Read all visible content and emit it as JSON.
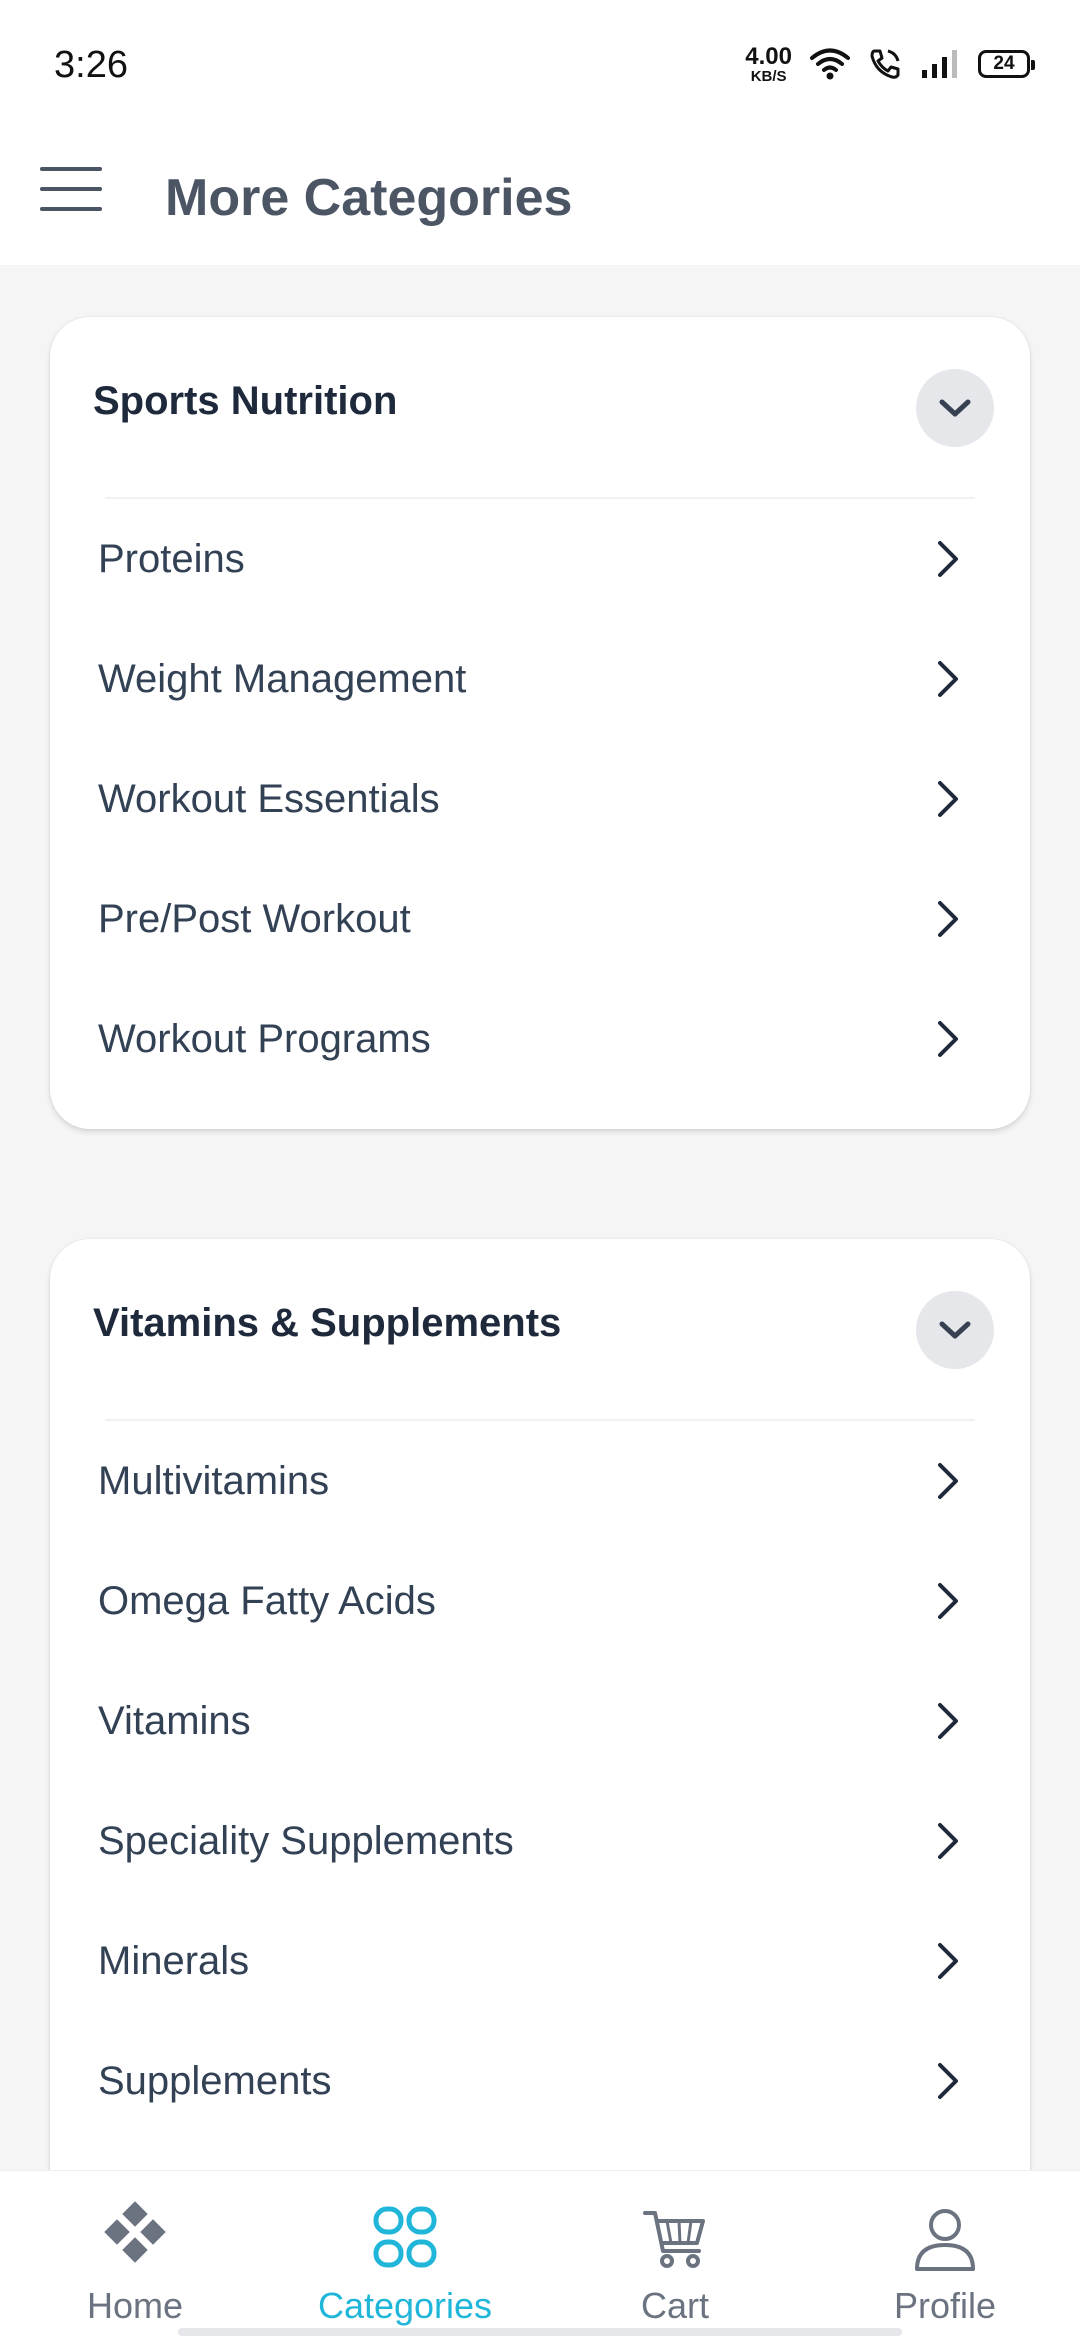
{
  "status": {
    "time": "3:26",
    "net_speed_value": "4.00",
    "net_speed_unit": "KB/S",
    "battery": "24"
  },
  "app_bar": {
    "title": "More Categories"
  },
  "sections": [
    {
      "title": "Sports Nutrition",
      "items": [
        "Proteins",
        "Weight Management",
        "Workout Essentials",
        "Pre/Post Workout",
        "Workout Programs"
      ]
    },
    {
      "title": "Vitamins & Supplements",
      "items": [
        "Multivitamins",
        "Omega Fatty Acids",
        "Vitamins",
        "Speciality Supplements",
        "Minerals",
        "Supplements"
      ]
    }
  ],
  "nav": {
    "items": [
      {
        "label": "Home",
        "icon": "home-icon"
      },
      {
        "label": "Categories",
        "icon": "categories-icon"
      },
      {
        "label": "Cart",
        "icon": "cart-icon"
      },
      {
        "label": "Profile",
        "icon": "profile-icon"
      }
    ],
    "active": "Categories"
  },
  "colors": {
    "accent": "#1fb6d9",
    "title_text": "#4b5563",
    "card_title": "#1e293b"
  }
}
